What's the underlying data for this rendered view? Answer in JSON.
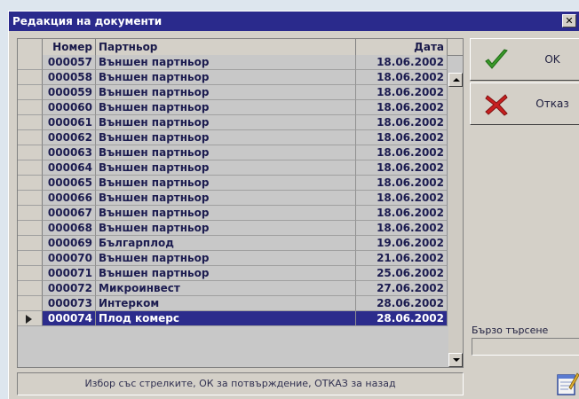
{
  "window": {
    "title": "Редакция на документи",
    "close_glyph": "✕"
  },
  "grid": {
    "columns": [
      "Номер",
      "Партньор",
      "Дата"
    ],
    "rows": [
      {
        "number": "000057",
        "partner": "Външен партньор",
        "date": "18.06.2002"
      },
      {
        "number": "000058",
        "partner": "Външен партньор",
        "date": "18.06.2002"
      },
      {
        "number": "000059",
        "partner": "Външен партньор",
        "date": "18.06.2002"
      },
      {
        "number": "000060",
        "partner": "Външен партньор",
        "date": "18.06.2002"
      },
      {
        "number": "000061",
        "partner": "Външен партньор",
        "date": "18.06.2002"
      },
      {
        "number": "000062",
        "partner": "Външен партньор",
        "date": "18.06.2002"
      },
      {
        "number": "000063",
        "partner": "Външен партньор",
        "date": "18.06.2002"
      },
      {
        "number": "000064",
        "partner": "Външен партньор",
        "date": "18.06.2002"
      },
      {
        "number": "000065",
        "partner": "Външен партньор",
        "date": "18.06.2002"
      },
      {
        "number": "000066",
        "partner": "Външен партньор",
        "date": "18.06.2002"
      },
      {
        "number": "000067",
        "partner": "Външен партньор",
        "date": "18.06.2002"
      },
      {
        "number": "000068",
        "partner": "Външен партньор",
        "date": "18.06.2002"
      },
      {
        "number": "000069",
        "partner": "Българплод",
        "date": "19.06.2002"
      },
      {
        "number": "000070",
        "partner": "Външен партньор",
        "date": "21.06.2002"
      },
      {
        "number": "000071",
        "partner": "Външен партньор",
        "date": "25.06.2002"
      },
      {
        "number": "000072",
        "partner": "Микроинвест",
        "date": "27.06.2002"
      },
      {
        "number": "000073",
        "partner": "Интерком",
        "date": "28.06.2002"
      },
      {
        "number": "000074",
        "partner": "Плод комерс",
        "date": "28.06.2002"
      }
    ],
    "selected_index": 17
  },
  "status_text": "Избор със стрелките, ОК за потвърждение, ОТКАЗ за назад",
  "buttons": {
    "ok_label": "OK",
    "cancel_label": "Отказ"
  },
  "search": {
    "label": "Бързо търсене",
    "value": ""
  },
  "colors": {
    "title_bar": "#2a2a8c",
    "selection": "#2c2c8c",
    "ok_check": "#3a9a2a",
    "cancel_x": "#c82020"
  },
  "icons": {
    "ok": "checkmark-icon",
    "cancel": "cross-icon",
    "notes": "notepad-icon",
    "row_pointer": "row-pointer-icon"
  }
}
